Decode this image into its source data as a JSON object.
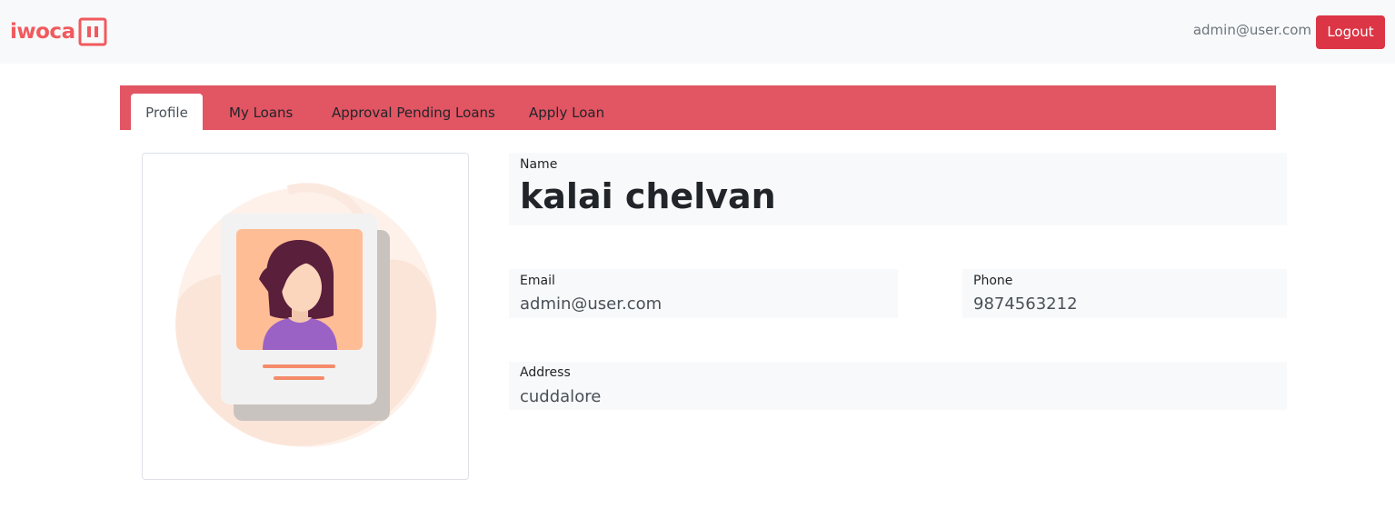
{
  "navbar": {
    "brand": "iwoca",
    "brand_color": "#f05a5e",
    "user_email": "admin@user.com",
    "logout_label": "Logout",
    "logout_color": "#dc3545"
  },
  "tabs": {
    "bar_color": "#e25563",
    "items": [
      {
        "label": "Profile",
        "active": true
      },
      {
        "label": "My Loans",
        "active": false
      },
      {
        "label": "Approval Pending Loans",
        "active": false
      },
      {
        "label": "Apply Loan",
        "active": false
      }
    ]
  },
  "profile": {
    "avatar_icon": "user-profile-card-illustration",
    "name_label": "Name",
    "name_value": "kalai chelvan",
    "email_label": "Email",
    "email_value": "admin@user.com",
    "phone_label": "Phone",
    "phone_value": "9874563212",
    "address_label": "Address",
    "address_value": "cuddalore"
  }
}
